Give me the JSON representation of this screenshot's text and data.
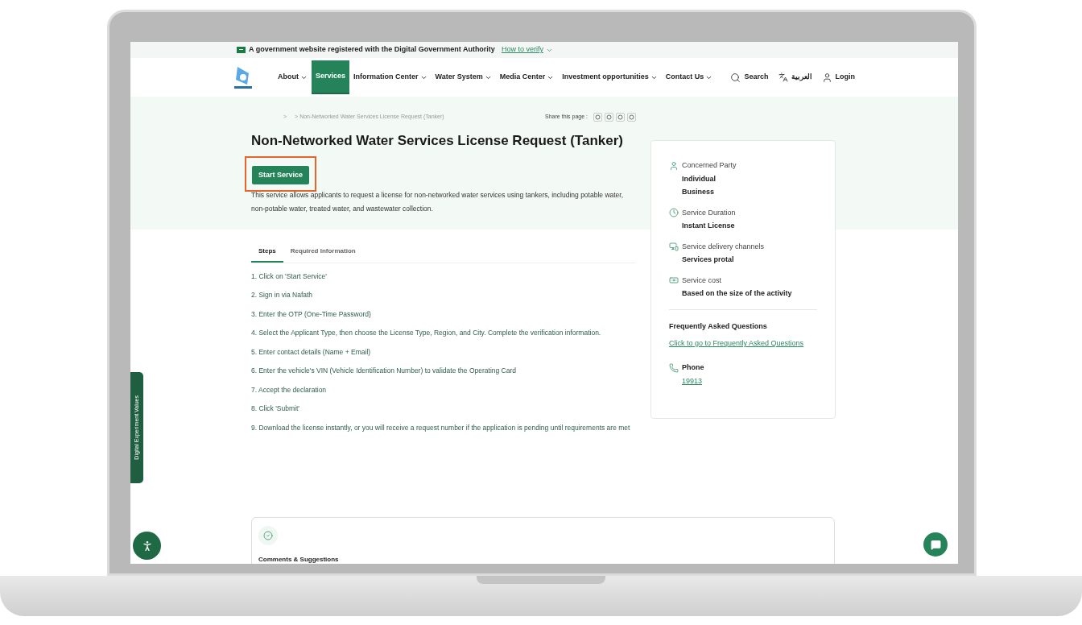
{
  "banner": {
    "text": "A government website registered with the Digital Government Authority",
    "link": "How to verify"
  },
  "nav": {
    "items": [
      {
        "label": "About",
        "has_menu": true,
        "selected": false
      },
      {
        "label": "Services",
        "has_menu": false,
        "selected": true
      },
      {
        "label": "Information Center",
        "has_menu": true,
        "selected": false
      },
      {
        "label": "Water System",
        "has_menu": true,
        "selected": false
      },
      {
        "label": "Media Center",
        "has_menu": true,
        "selected": false
      },
      {
        "label": "Investment opportunities",
        "has_menu": true,
        "selected": false
      },
      {
        "label": "Contact Us",
        "has_menu": true,
        "selected": false
      }
    ],
    "search": "Search",
    "language": "العربية",
    "login": "Login"
  },
  "breadcrumb": [
    ">",
    "> Non-Networked Water Services License Request (Tanker)"
  ],
  "share": {
    "label": "Share this page :"
  },
  "title": "Non-Networked Water Services License Request (Tanker)",
  "start_button": {
    "label": "Start Service",
    "highlighted": true
  },
  "description": "This service allows applicants to request a license for non-networked water services using tankers, including potable water, non-potable water, treated water, and wastewater collection.",
  "tabs": [
    {
      "label": "Steps",
      "selected": true
    },
    {
      "label": "Required Information",
      "selected": false
    }
  ],
  "steps": [
    "1. Click on 'Start Service'",
    "2. Sign in via Nafath",
    "3. Enter the OTP (One-Time Password)",
    "4. Select the Applicant Type, then choose the License Type, Region, and City. Complete the verification information.",
    "5. Enter contact details (Name + Email)",
    "6. Enter the vehicle's VIN (Vehicle Identification Number) to validate the Operating Card",
    "7. Accept the declaration",
    "8. Click 'Submit'",
    "9. Download the license instantly, or you will receive a request number if the application is pending until requirements are met"
  ],
  "info_card": {
    "fields": [
      {
        "kind": "person",
        "label": "Concerned Party",
        "values": [
          "Individual",
          "Business"
        ]
      },
      {
        "kind": "clock",
        "label": "Service Duration",
        "values": [
          "Instant License"
        ]
      },
      {
        "kind": "monitor",
        "label": "Service delivery channels",
        "values": [
          "Services protal"
        ]
      },
      {
        "kind": "cash",
        "label": "Service cost",
        "values": [
          "Based on the size of the activity"
        ]
      }
    ],
    "faq": {
      "title": "Frequently Asked Questions",
      "link": "Click to go to Frequently Asked Questions"
    },
    "phone": {
      "label": "Phone",
      "number": "19913"
    }
  },
  "side_tab": "Digital Experiment Values",
  "feedback": {
    "title": "Comments & Suggestions"
  }
}
